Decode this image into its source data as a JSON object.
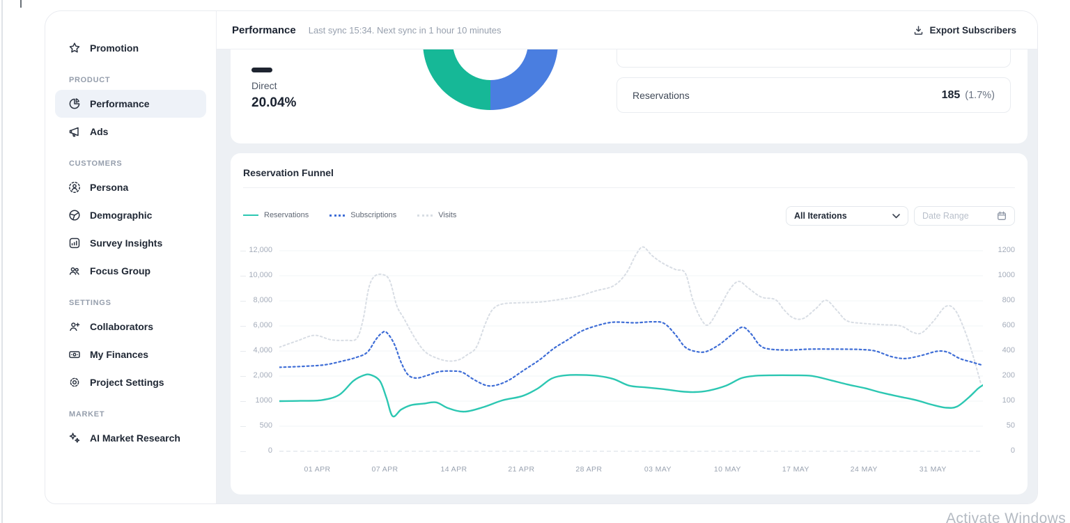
{
  "sidebar": {
    "sections": [
      {
        "label": "",
        "items": [
          {
            "label": "Promotion",
            "icon": "star",
            "active": false
          }
        ]
      },
      {
        "label": "PRODUCT",
        "items": [
          {
            "label": "Performance",
            "icon": "pie",
            "active": true
          },
          {
            "label": "Ads",
            "icon": "megaphone",
            "active": false
          }
        ]
      },
      {
        "label": "CUSTOMERS",
        "items": [
          {
            "label": "Persona",
            "icon": "persona",
            "active": false
          },
          {
            "label": "Demographic",
            "icon": "globe",
            "active": false
          },
          {
            "label": "Survey Insights",
            "icon": "survey",
            "active": false
          },
          {
            "label": "Focus Group",
            "icon": "people",
            "active": false
          }
        ]
      },
      {
        "label": "SETTINGS",
        "items": [
          {
            "label": "Collaborators",
            "icon": "person-plus",
            "active": false
          },
          {
            "label": "My Finances",
            "icon": "banknote",
            "active": false
          },
          {
            "label": "Project Settings",
            "icon": "gear",
            "active": false
          }
        ]
      },
      {
        "label": "MARKET",
        "items": [
          {
            "label": "AI Market Research",
            "icon": "sparkles",
            "active": false
          }
        ]
      }
    ]
  },
  "header": {
    "title": "Performance",
    "sync_status": "Last sync 15:34. Next sync in 1 hour 10 minutes",
    "export_label": "Export Subscribers"
  },
  "overview": {
    "direct_label": "Direct",
    "direct_value": "20.04%",
    "colors": {
      "direct_swatch": "#1e2430",
      "donut_teal": "#16b897",
      "donut_blue": "#4a7ee0"
    },
    "rows": [
      {
        "label": "Reservations",
        "value": "185",
        "percent": "(1.7%)"
      }
    ]
  },
  "funnel": {
    "title": "Reservation Funnel",
    "controls": {
      "iterations_value": "All Iterations",
      "date_range_placeholder": "Date Range"
    }
  },
  "chart_data": {
    "type": "line",
    "title": "Reservation Funnel",
    "grid": true,
    "legend_position": "top-left",
    "y_left_ticks": [
      "12,000",
      "10,000",
      "8,000",
      "6,000",
      "4,000",
      "2,000",
      "1000",
      "500",
      "0"
    ],
    "y_right_ticks": [
      "1200",
      "1000",
      "800",
      "600",
      "400",
      "200",
      "100",
      "50",
      "0"
    ],
    "axis_value_stops": [
      0,
      500,
      1000,
      2000,
      4000,
      6000,
      8000,
      10000,
      12000
    ],
    "x_ticks": [
      "01 APR",
      "07 APR",
      "14 APR",
      "21 APR",
      "28 APR",
      "03 MAY",
      "10 MAY",
      "17 MAY",
      "24 MAY",
      "31 MAY"
    ],
    "x_tick_fracs": [
      0.054,
      0.15,
      0.248,
      0.344,
      0.44,
      0.538,
      0.637,
      0.734,
      0.831,
      0.929
    ],
    "series": [
      {
        "name": "Visits",
        "color": "#d8dde4",
        "style": "dotted",
        "width": 2,
        "points": [
          [
            0,
            4300
          ],
          [
            0.025,
            4800
          ],
          [
            0.05,
            5250
          ],
          [
            0.073,
            4900
          ],
          [
            0.095,
            4850
          ],
          [
            0.11,
            5000
          ],
          [
            0.119,
            6500
          ],
          [
            0.127,
            9000
          ],
          [
            0.135,
            9950
          ],
          [
            0.147,
            10100
          ],
          [
            0.157,
            9600
          ],
          [
            0.167,
            7600
          ],
          [
            0.177,
            6600
          ],
          [
            0.193,
            5000
          ],
          [
            0.207,
            3950
          ],
          [
            0.223,
            3450
          ],
          [
            0.24,
            3200
          ],
          [
            0.255,
            3300
          ],
          [
            0.267,
            3700
          ],
          [
            0.28,
            4300
          ],
          [
            0.293,
            6200
          ],
          [
            0.303,
            7300
          ],
          [
            0.317,
            7750
          ],
          [
            0.343,
            7850
          ],
          [
            0.37,
            7900
          ],
          [
            0.397,
            8100
          ],
          [
            0.423,
            8350
          ],
          [
            0.45,
            8800
          ],
          [
            0.475,
            9200
          ],
          [
            0.493,
            10200
          ],
          [
            0.507,
            11700
          ],
          [
            0.517,
            12300
          ],
          [
            0.53,
            11600
          ],
          [
            0.545,
            11000
          ],
          [
            0.563,
            10500
          ],
          [
            0.577,
            10200
          ],
          [
            0.588,
            8000
          ],
          [
            0.6,
            6500
          ],
          [
            0.61,
            6100
          ],
          [
            0.625,
            7400
          ],
          [
            0.64,
            8900
          ],
          [
            0.653,
            9550
          ],
          [
            0.667,
            9000
          ],
          [
            0.685,
            8300
          ],
          [
            0.705,
            8100
          ],
          [
            0.717,
            7300
          ],
          [
            0.73,
            6650
          ],
          [
            0.745,
            6600
          ],
          [
            0.763,
            7400
          ],
          [
            0.777,
            8050
          ],
          [
            0.793,
            7200
          ],
          [
            0.807,
            6400
          ],
          [
            0.83,
            6200
          ],
          [
            0.857,
            6100
          ],
          [
            0.883,
            6000
          ],
          [
            0.9,
            5500
          ],
          [
            0.913,
            5450
          ],
          [
            0.93,
            6400
          ],
          [
            0.947,
            7550
          ],
          [
            0.96,
            7300
          ],
          [
            0.973,
            5800
          ],
          [
            0.985,
            3800
          ],
          [
            0.997,
            1700
          ]
        ]
      },
      {
        "name": "Subscriptions",
        "color": "#3e6dd6",
        "style": "dotted",
        "width": 2.2,
        "points": [
          [
            0,
            2700
          ],
          [
            0.035,
            2780
          ],
          [
            0.065,
            2900
          ],
          [
            0.09,
            3200
          ],
          [
            0.11,
            3500
          ],
          [
            0.125,
            3900
          ],
          [
            0.137,
            4900
          ],
          [
            0.145,
            5400
          ],
          [
            0.152,
            5500
          ],
          [
            0.163,
            4600
          ],
          [
            0.173,
            3100
          ],
          [
            0.183,
            2100
          ],
          [
            0.195,
            1920
          ],
          [
            0.21,
            2050
          ],
          [
            0.227,
            2350
          ],
          [
            0.245,
            2400
          ],
          [
            0.26,
            2300
          ],
          [
            0.277,
            1850
          ],
          [
            0.295,
            1620
          ],
          [
            0.31,
            1650
          ],
          [
            0.327,
            1850
          ],
          [
            0.347,
            2450
          ],
          [
            0.37,
            3300
          ],
          [
            0.39,
            4200
          ],
          [
            0.41,
            4900
          ],
          [
            0.43,
            5600
          ],
          [
            0.453,
            6050
          ],
          [
            0.475,
            6300
          ],
          [
            0.505,
            6250
          ],
          [
            0.53,
            6330
          ],
          [
            0.547,
            6200
          ],
          [
            0.563,
            5300
          ],
          [
            0.577,
            4300
          ],
          [
            0.593,
            3950
          ],
          [
            0.607,
            3960
          ],
          [
            0.625,
            4500
          ],
          [
            0.643,
            5300
          ],
          [
            0.658,
            5900
          ],
          [
            0.67,
            5400
          ],
          [
            0.683,
            4450
          ],
          [
            0.697,
            4150
          ],
          [
            0.725,
            4080
          ],
          [
            0.755,
            4150
          ],
          [
            0.79,
            4150
          ],
          [
            0.825,
            4120
          ],
          [
            0.847,
            4000
          ],
          [
            0.87,
            3550
          ],
          [
            0.89,
            3400
          ],
          [
            0.913,
            3650
          ],
          [
            0.935,
            3980
          ],
          [
            0.95,
            3900
          ],
          [
            0.967,
            3400
          ],
          [
            0.985,
            3100
          ],
          [
            1,
            2850
          ]
        ]
      },
      {
        "name": "Reservations",
        "color": "#2cc7b2",
        "style": "solid",
        "width": 2.4,
        "points": [
          [
            0,
            1000
          ],
          [
            0.03,
            1010
          ],
          [
            0.06,
            1040
          ],
          [
            0.085,
            1250
          ],
          [
            0.105,
            1800
          ],
          [
            0.12,
            2060
          ],
          [
            0.13,
            2090
          ],
          [
            0.143,
            1800
          ],
          [
            0.152,
            1150
          ],
          [
            0.161,
            700
          ],
          [
            0.173,
            830
          ],
          [
            0.187,
            920
          ],
          [
            0.205,
            950
          ],
          [
            0.223,
            975
          ],
          [
            0.24,
            860
          ],
          [
            0.263,
            790
          ],
          [
            0.29,
            880
          ],
          [
            0.317,
            1030
          ],
          [
            0.345,
            1200
          ],
          [
            0.367,
            1500
          ],
          [
            0.387,
            1900
          ],
          [
            0.407,
            2060
          ],
          [
            0.43,
            2090
          ],
          [
            0.453,
            2010
          ],
          [
            0.475,
            1880
          ],
          [
            0.497,
            1620
          ],
          [
            0.52,
            1550
          ],
          [
            0.545,
            1480
          ],
          [
            0.57,
            1390
          ],
          [
            0.59,
            1360
          ],
          [
            0.61,
            1420
          ],
          [
            0.635,
            1620
          ],
          [
            0.657,
            1920
          ],
          [
            0.677,
            2020
          ],
          [
            0.7,
            2060
          ],
          [
            0.73,
            2060
          ],
          [
            0.757,
            2010
          ],
          [
            0.783,
            1840
          ],
          [
            0.807,
            1670
          ],
          [
            0.833,
            1510
          ],
          [
            0.857,
            1330
          ],
          [
            0.883,
            1170
          ],
          [
            0.905,
            1040
          ],
          [
            0.927,
            930
          ],
          [
            0.947,
            870
          ],
          [
            0.963,
            890
          ],
          [
            0.98,
            1150
          ],
          [
            0.993,
            1500
          ],
          [
            1,
            1640
          ]
        ]
      }
    ],
    "chart_legend": [
      {
        "label": "Reservations",
        "color": "#2cc7b2",
        "style": "solid"
      },
      {
        "label": "Subscriptions",
        "color": "#3e6dd6",
        "style": "dotted"
      },
      {
        "label": "Visits",
        "color": "#d8dde4",
        "style": "dotted"
      }
    ]
  },
  "watermark": {
    "text": "Activate Windows"
  }
}
